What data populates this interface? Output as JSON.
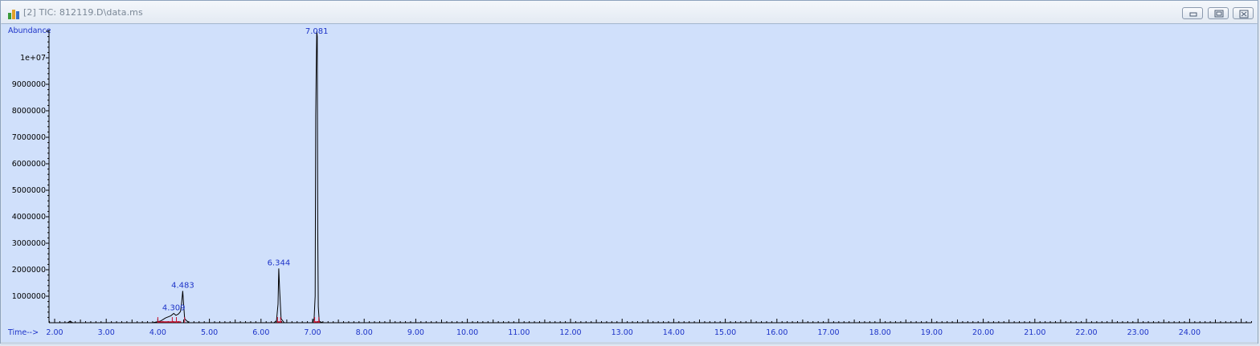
{
  "window": {
    "title": "[2] TIC: 812119.D\\data.ms",
    "controls": [
      "minimize",
      "maximize",
      "close"
    ]
  },
  "chart_data": {
    "type": "line",
    "ylabel": "Abundance",
    "xlabel": "Time-->",
    "xlim": [
      1.9,
      25.2
    ],
    "ylim": [
      0,
      11000000
    ],
    "x_ticks": [
      "2.00",
      "3.00",
      "4.00",
      "5.00",
      "6.00",
      "7.00",
      "8.00",
      "9.00",
      "10.00",
      "11.00",
      "12.00",
      "13.00",
      "14.00",
      "15.00",
      "16.00",
      "17.00",
      "18.00",
      "19.00",
      "20.00",
      "21.00",
      "22.00",
      "23.00",
      "24.00"
    ],
    "y_ticks": [
      "1000000",
      "2000000",
      "3000000",
      "4000000",
      "5000000",
      "6000000",
      "7000000",
      "8000000",
      "9000000",
      "1e+07"
    ],
    "peak_labels": [
      "4.309",
      "4.483",
      "6.344",
      "7.081"
    ],
    "series": [
      {
        "line_color": "#000000",
        "x": [
          1.9,
          2.25,
          2.3,
          2.35,
          3.9,
          4.05,
          4.15,
          4.25,
          4.309,
          4.35,
          4.4,
          4.44,
          4.46,
          4.483,
          4.5,
          4.52,
          4.6,
          5.5,
          6.25,
          6.3,
          6.33,
          6.344,
          6.36,
          6.39,
          6.45,
          7.0,
          7.03,
          7.05,
          7.06,
          7.07,
          7.081,
          7.09,
          7.1,
          7.11,
          7.13,
          7.2,
          25.2
        ],
        "y": [
          0,
          0,
          60000,
          0,
          0,
          60000,
          180000,
          260000,
          350000,
          280000,
          330000,
          420000,
          700000,
          1200000,
          700000,
          150000,
          0,
          0,
          0,
          80000,
          700000,
          2050000,
          1300000,
          150000,
          0,
          0,
          150000,
          1000000,
          7800000,
          9500000,
          11000000,
          10800000,
          3500000,
          600000,
          50000,
          0,
          0
        ]
      }
    ]
  }
}
